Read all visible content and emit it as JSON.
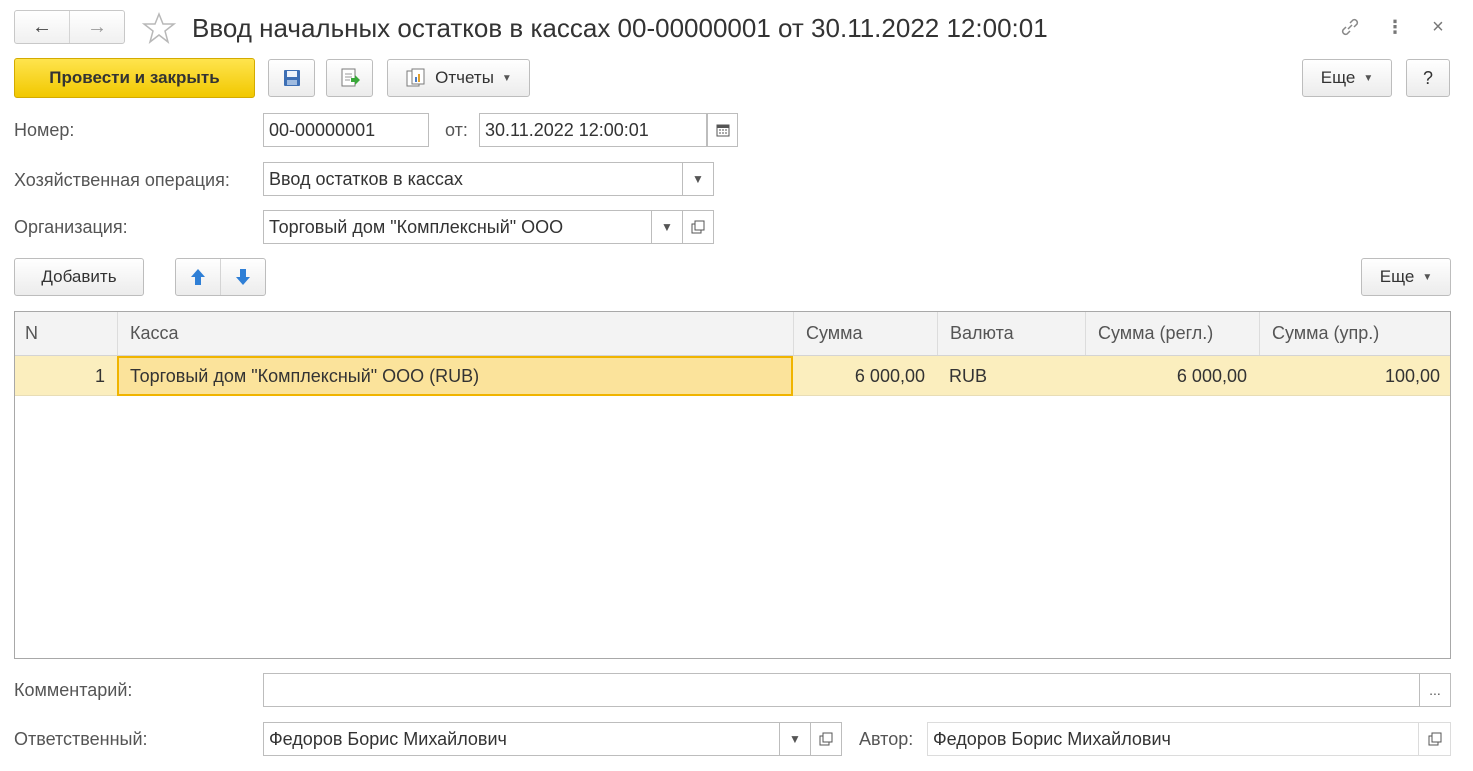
{
  "window": {
    "title": "Ввод начальных остатков в кассах 00-00000001 от 30.11.2022 12:00:01",
    "back_glyph": "←",
    "forward_glyph": "→",
    "link_glyph": "🔗",
    "menu_glyph": "⋮",
    "close_glyph": "×"
  },
  "toolbar": {
    "post_and_close": "Провести и закрыть",
    "reports": "Отчеты",
    "more": "Еще",
    "help": "?"
  },
  "form": {
    "number_label": "Номер:",
    "number_value": "00-00000001",
    "date_label": "от:",
    "date_value": "30.11.2022 12:00:01",
    "operation_label": "Хозяйственная операция:",
    "operation_value": "Ввод остатков в кассах",
    "org_label": "Организация:",
    "org_value": "Торговый дом \"Комплексный\" ООО"
  },
  "table_toolbar": {
    "add": "Добавить",
    "more": "Еще"
  },
  "table": {
    "columns": [
      "N",
      "Касса",
      "Сумма",
      "Валюта",
      "Сумма (регл.)",
      "Сумма (упр.)"
    ],
    "rows": [
      {
        "n": "1",
        "cash": "Торговый дом \"Комплексный\" ООО (RUB)",
        "amount": "6 000,00",
        "currency": "RUB",
        "amount_reg": "6 000,00",
        "amount_mgmt": "100,00"
      }
    ]
  },
  "footer": {
    "comment_label": "Комментарий:",
    "comment_value": "",
    "ellipsis": "...",
    "responsible_label": "Ответственный:",
    "responsible_value": "Федоров Борис Михайлович",
    "author_label": "Автор:",
    "author_value": "Федоров Борис Михайлович"
  },
  "colors": {
    "primary_button": "#f1c800",
    "selected_row": "#fbeebe",
    "selected_cell_border": "#f0b400",
    "arrow_blue": "#2f7fd6"
  }
}
